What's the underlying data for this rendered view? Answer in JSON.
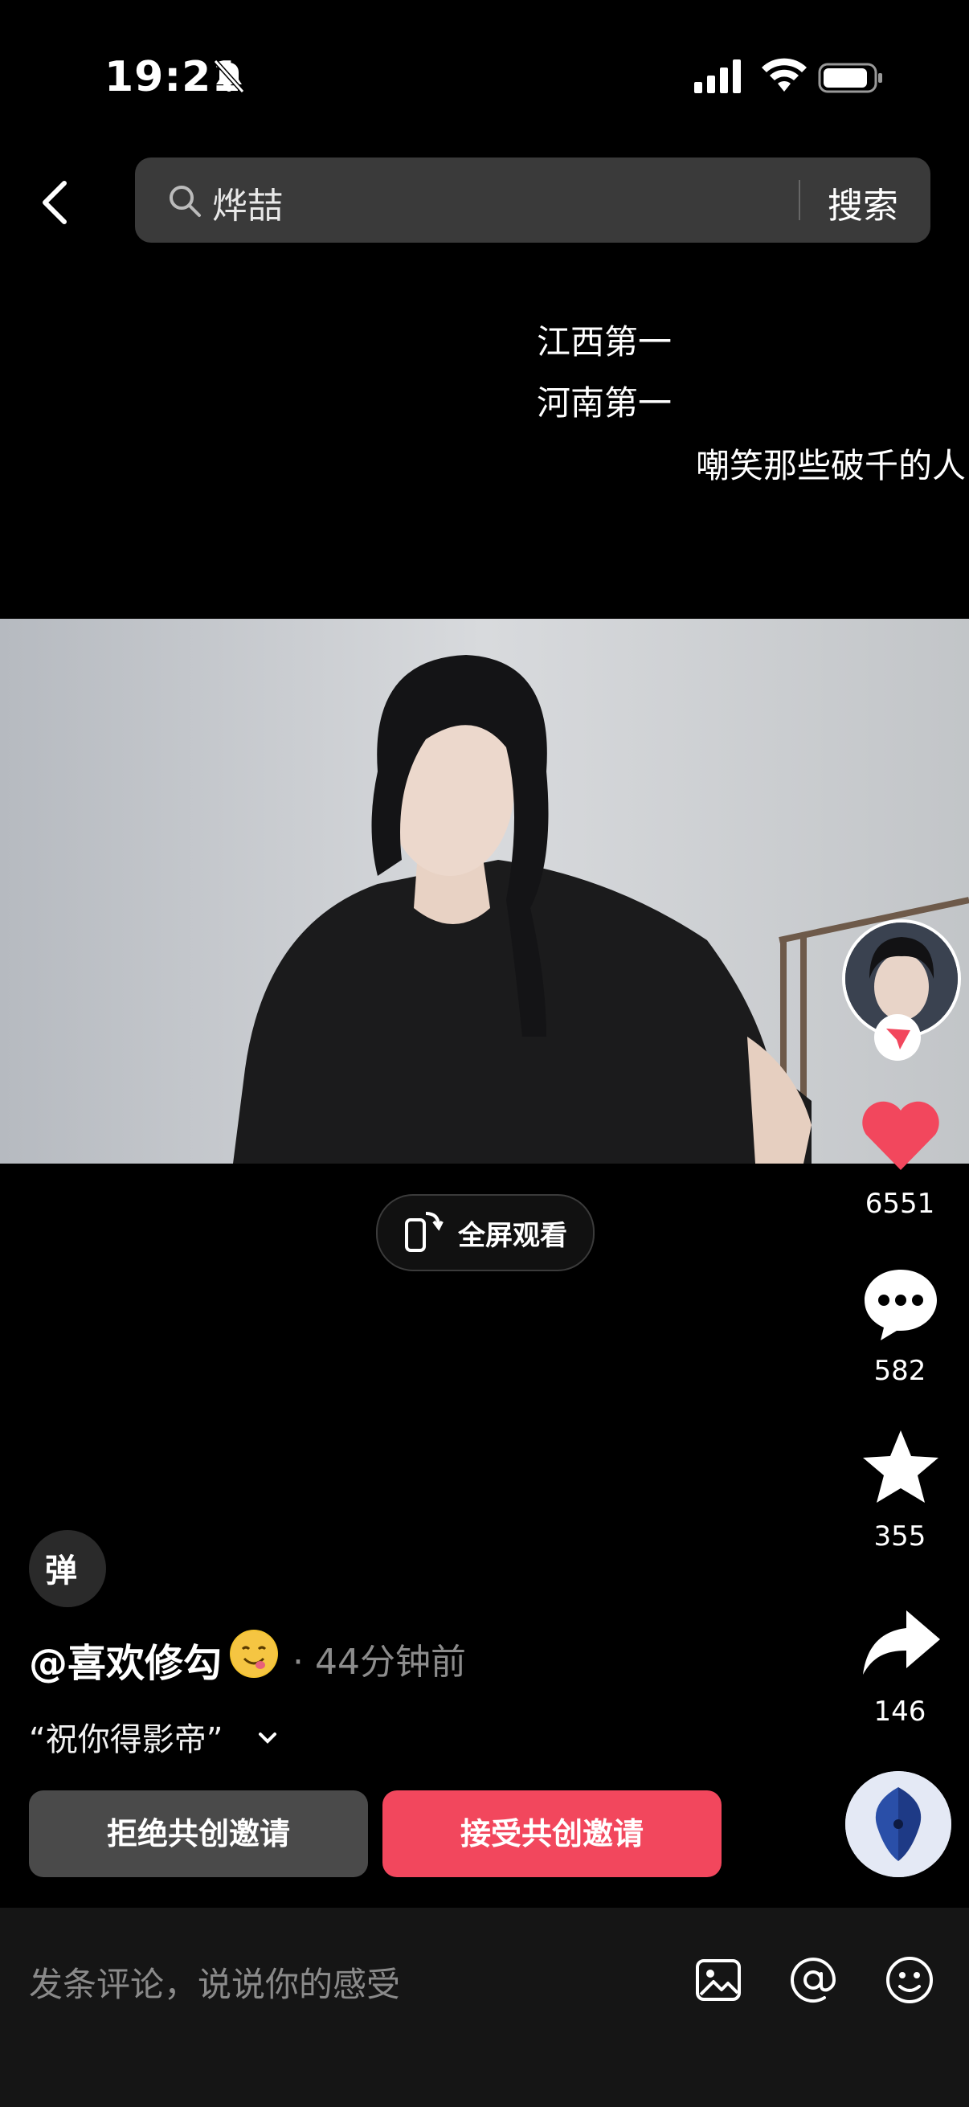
{
  "status_bar": {
    "time": "19:21"
  },
  "header": {
    "search_query": "烨喆",
    "search_button": "搜索"
  },
  "danmaku": [
    "江西第一",
    "河南第一",
    "嘲笑那些破千的人"
  ],
  "video": {
    "fullscreen_label": "全屏观看"
  },
  "actions": {
    "likes": "6551",
    "comments": "582",
    "favorites": "355",
    "shares": "146"
  },
  "post": {
    "danmu_toggle": "弹",
    "author": "@喜欢修勾",
    "time_ago": "· 44分钟前",
    "caption": "“祝你得影帝”"
  },
  "co_create": {
    "reject": "拒绝共创邀请",
    "accept": "接受共创邀请"
  },
  "comment_bar": {
    "placeholder": "发条评论，说说你的感受"
  },
  "colors": {
    "accent": "#f2475d",
    "like": "#f2475d",
    "background": "#000000"
  }
}
